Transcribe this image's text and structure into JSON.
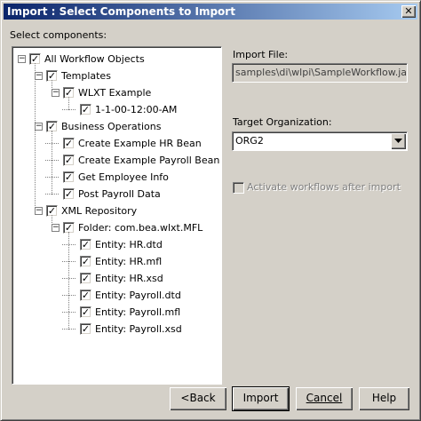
{
  "window": {
    "title": "Import : Select Components to Import",
    "close_label": "✕"
  },
  "left": {
    "select_label": "Select components:"
  },
  "tree": [
    {
      "label": "All Workflow Objects",
      "checked": true
    },
    {
      "label": "Templates",
      "checked": true
    },
    {
      "label": "WLXT Example",
      "checked": true
    },
    {
      "label": "1-1-00-12:00-AM",
      "checked": true
    },
    {
      "label": "Business Operations",
      "checked": true
    },
    {
      "label": "Create Example HR Bean",
      "checked": true
    },
    {
      "label": "Create Example Payroll Bean",
      "checked": true
    },
    {
      "label": "Get Employee Info",
      "checked": true
    },
    {
      "label": "Post Payroll Data",
      "checked": true
    },
    {
      "label": "XML Repository",
      "checked": true
    },
    {
      "label": "Folder: com.bea.wlxt.MFL",
      "checked": true
    },
    {
      "label": "Entity: HR.dtd",
      "checked": true
    },
    {
      "label": "Entity: HR.mfl",
      "checked": true
    },
    {
      "label": "Entity: HR.xsd",
      "checked": true
    },
    {
      "label": "Entity: Payroll.dtd",
      "checked": true
    },
    {
      "label": "Entity: Payroll.mfl",
      "checked": true
    },
    {
      "label": "Entity: Payroll.xsd",
      "checked": true
    }
  ],
  "expander_symbol": "−",
  "check_symbol": "✓",
  "right": {
    "import_file_label": "Import File:",
    "import_file_value": "samples\\di\\wlpi\\SampleWorkflow.jar",
    "target_org_label": "Target Organization:",
    "target_org_value": "ORG2",
    "activate_label": "Activate workflows after import",
    "activate_checked": false,
    "activate_enabled": false
  },
  "buttons": {
    "back": "<Back",
    "import": "Import",
    "cancel": "Cancel",
    "help": "Help"
  },
  "colors": {
    "title_start": "#0a246a",
    "title_end": "#a6caf0",
    "face": "#d4d0c8",
    "disabled_text": "#808080"
  }
}
